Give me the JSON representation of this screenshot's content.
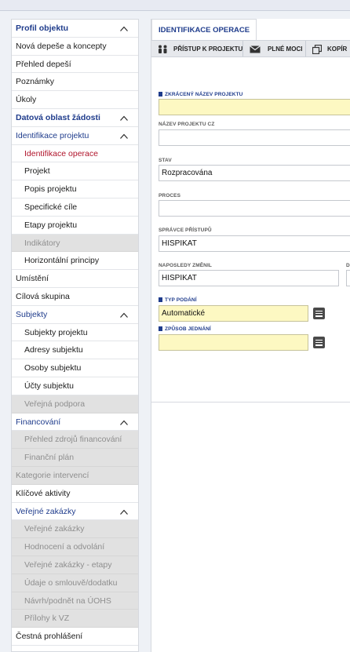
{
  "nav": [
    {
      "label": "Profil objektu",
      "type": "section",
      "chevron": true
    },
    {
      "label": "Nová depeše a koncepty",
      "type": "item"
    },
    {
      "label": "Přehled depeší",
      "type": "item"
    },
    {
      "label": "Poznámky",
      "type": "item"
    },
    {
      "label": "Úkoly",
      "type": "item"
    },
    {
      "label": "Datová oblast žádosti",
      "type": "section",
      "chevron": true
    },
    {
      "label": "Identifikace projektu",
      "type": "group",
      "chevron": true
    },
    {
      "label": "Identifikace operace",
      "type": "sub-active"
    },
    {
      "label": "Projekt",
      "type": "sub"
    },
    {
      "label": "Popis projektu",
      "type": "sub"
    },
    {
      "label": "Specifické cíle",
      "type": "sub"
    },
    {
      "label": "Etapy projektu",
      "type": "sub"
    },
    {
      "label": "Indikátory",
      "type": "sub-disabled"
    },
    {
      "label": "Horizontální principy",
      "type": "sub"
    },
    {
      "label": "Umístění",
      "type": "item"
    },
    {
      "label": "Cílová skupina",
      "type": "item"
    },
    {
      "label": "Subjekty",
      "type": "group",
      "chevron": true
    },
    {
      "label": "Subjekty projektu",
      "type": "sub"
    },
    {
      "label": "Adresy subjektu",
      "type": "sub"
    },
    {
      "label": "Osoby subjektu",
      "type": "sub"
    },
    {
      "label": "Účty subjektu",
      "type": "sub"
    },
    {
      "label": "Veřejná podpora",
      "type": "sub-disabled"
    },
    {
      "label": "Financování",
      "type": "group",
      "chevron": true
    },
    {
      "label": "Přehled zdrojů financování",
      "type": "sub-disabled"
    },
    {
      "label": "Finanční plán",
      "type": "sub-disabled"
    },
    {
      "label": "Kategorie intervencí",
      "type": "disabled"
    },
    {
      "label": "Klíčové aktivity",
      "type": "item"
    },
    {
      "label": "Veřejné zakázky",
      "type": "group",
      "chevron": true
    },
    {
      "label": "Veřejné zakázky",
      "type": "sub-disabled"
    },
    {
      "label": "Hodnocení a odvolání",
      "type": "sub-disabled"
    },
    {
      "label": "Veřejné zakázky - etapy",
      "type": "sub-disabled"
    },
    {
      "label": "Údaje o smlouvě/dodatku",
      "type": "sub-disabled"
    },
    {
      "label": "Návrh/podnět na ÚOHS",
      "type": "sub-disabled"
    },
    {
      "label": "Přílohy k VZ",
      "type": "sub-disabled"
    },
    {
      "label": "Čestná prohlášení",
      "type": "item"
    }
  ],
  "tab": {
    "title": "IDENTIFIKACE OPERACE"
  },
  "toolbar": {
    "access": "PŘÍSTUP K PROJEKTU",
    "power": "PLNÉ MOCI",
    "copy": "KOPÍR"
  },
  "form": {
    "short_name": {
      "label": "ZKRÁCENÝ NÁZEV PROJEKTU",
      "value": ""
    },
    "name_cz": {
      "label": "NÁZEV PROJEKTU CZ",
      "value": ""
    },
    "status": {
      "label": "STAV",
      "value": "Rozpracována"
    },
    "process": {
      "label": "PROCES",
      "value": ""
    },
    "access_admin": {
      "label": "SPRÁVCE PŘÍSTUPŮ",
      "value": "HISPIKAT"
    },
    "last_changed": {
      "label": "NAPOSLEDY ZMĚNIL",
      "value": "HISPIKAT"
    },
    "last_changed_date_label": "D",
    "submission_type": {
      "label": "TYP PODÁNÍ",
      "value": "Automatické"
    },
    "negotiation_mode": {
      "label": "ZPŮSOB JEDNÁNÍ",
      "value": ""
    }
  }
}
